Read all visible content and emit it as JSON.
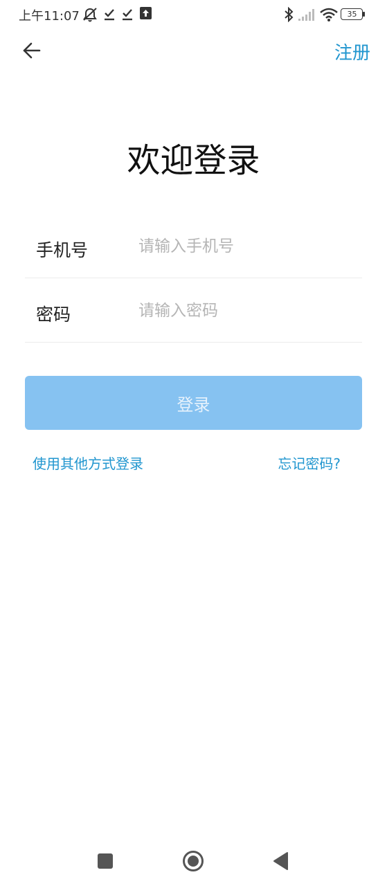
{
  "status_bar": {
    "time": "上午11:07",
    "battery": "35",
    "icons": [
      "muted-alarm-icon",
      "download-done-icon",
      "download-done-icon",
      "upload-icon",
      "bluetooth-icon",
      "signal-icon",
      "wifi-icon",
      "battery-icon"
    ]
  },
  "header": {
    "back_icon": "arrow-left-icon",
    "register_label": "注册"
  },
  "title": "欢迎登录",
  "form": {
    "phone_label": "手机号",
    "phone_placeholder": "请输入手机号",
    "phone_value": "",
    "password_label": "密码",
    "password_placeholder": "请输入密码",
    "password_value": ""
  },
  "login_button_label": "登录",
  "alt_login_label": "使用其他方式登录",
  "forgot_password_label": "忘记密码?",
  "nav_bar": {
    "icons": [
      "recents-square-icon",
      "home-circle-icon",
      "back-triangle-icon"
    ]
  },
  "colors": {
    "accent": "#2196cf",
    "button_disabled": "#86c2f1",
    "placeholder": "#b5b5b5",
    "divider": "#ebebeb"
  }
}
